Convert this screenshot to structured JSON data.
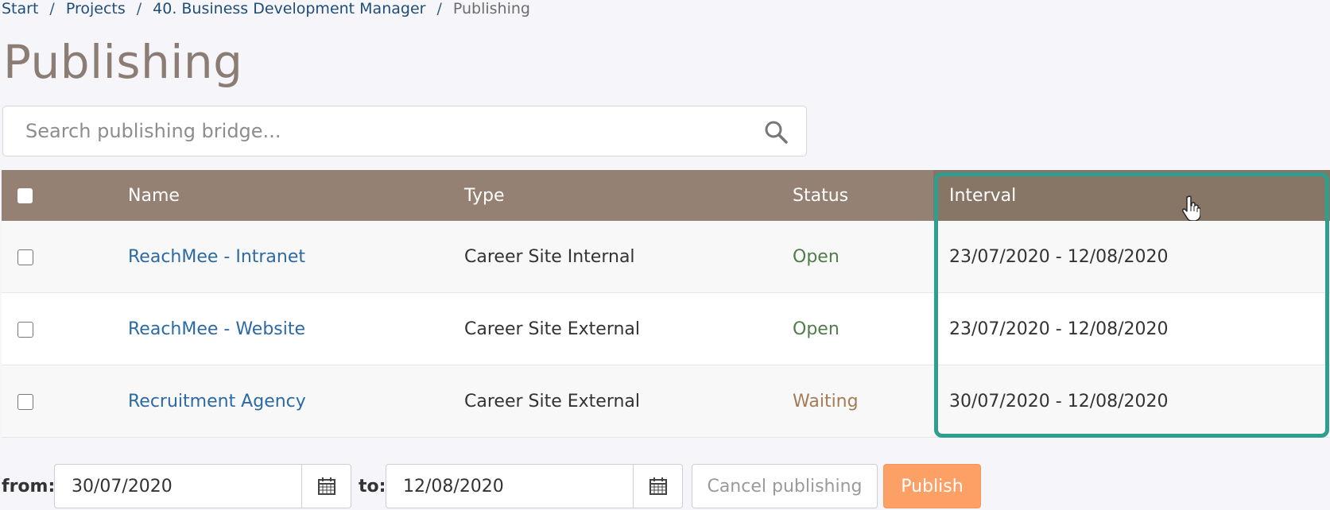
{
  "breadcrumb": {
    "items": [
      "Start",
      "Projects",
      "40. Business Development Manager"
    ],
    "current": "Publishing",
    "separator": "/"
  },
  "page": {
    "title": "Publishing"
  },
  "search": {
    "placeholder": "Search publishing bridge...",
    "value": ""
  },
  "table": {
    "headers": {
      "name": "Name",
      "type": "Type",
      "status": "Status",
      "interval": "Interval"
    },
    "rows": [
      {
        "name": "ReachMee - Intranet",
        "type": "Career Site Internal",
        "status": "Open",
        "interval": "23/07/2020 - 12/08/2020"
      },
      {
        "name": "ReachMee - Website",
        "type": "Career Site External",
        "status": "Open",
        "interval": "23/07/2020 - 12/08/2020"
      },
      {
        "name": "Recruitment Agency",
        "type": "Career Site External",
        "status": "Waiting",
        "interval": "30/07/2020 - 12/08/2020"
      }
    ]
  },
  "footer": {
    "from_label": "from:",
    "from_value": "30/07/2020",
    "to_label": "to:",
    "to_value": "12/08/2020",
    "cancel_label": "Cancel publishing",
    "publish_label": "Publish"
  },
  "colors": {
    "header_bg": "#948174",
    "highlight": "#2f9e8e",
    "publish": "#fca066",
    "link": "#2c6aa3"
  }
}
